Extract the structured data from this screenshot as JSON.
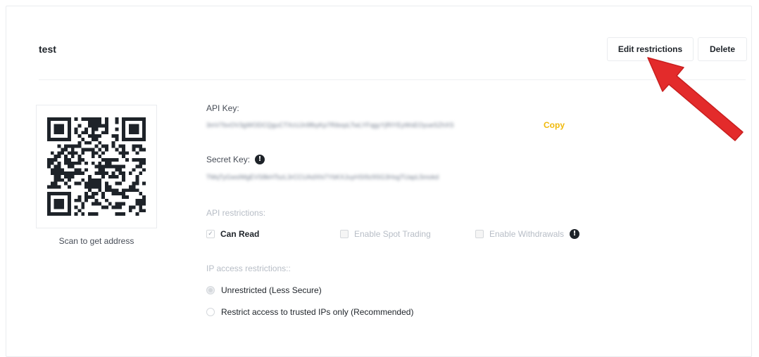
{
  "api_key": {
    "name": "test",
    "edit_label": "Edit restrictions",
    "delete_label": "Delete",
    "qr_caption": "Scan to get address",
    "api_key_label": "API Key:",
    "api_key_value": "3mV7bvOV3gWODCQguCTXcUJn9fbyKp7RibopLTwLYFqgyYjRIYEyWsEOyueSZhXS",
    "copy_label": "Copy",
    "secret_key_label": "Secret Key:",
    "secret_key_value": "TMqTyGwsIMgEVS8kHTszL3rCCUAdXhi7YbKXJuyHSI9z9SG3HsgTUapL5mokd",
    "api_restrictions_label": "API restrictions:",
    "permissions": [
      {
        "label": "Can Read",
        "checked": true,
        "enabled": true
      },
      {
        "label": "Enable Spot Trading",
        "checked": false,
        "enabled": false
      },
      {
        "label": "Enable Withdrawals",
        "checked": false,
        "enabled": false
      }
    ],
    "ip_restrictions_label": "IP access restrictions::",
    "ip_options": [
      {
        "label": "Unrestricted (Less Secure)",
        "selected": true
      },
      {
        "label": "Restrict access to trusted IPs only (Recommended)",
        "selected": false
      }
    ]
  },
  "colors": {
    "accent": "#f0b90b",
    "annotation_arrow": "#e32b2b"
  },
  "icons": {
    "info": "info-circle-icon",
    "check": "checkmark-icon",
    "qr": "qr-code-icon"
  }
}
